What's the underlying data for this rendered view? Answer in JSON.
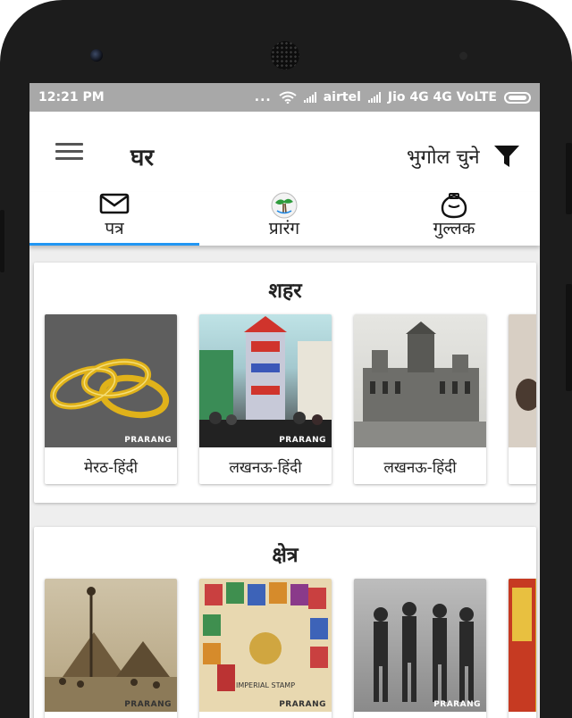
{
  "status_bar": {
    "time": "12:21 PM",
    "dots": "...",
    "carrier1": "airtel",
    "carrier2": "Jio 4G 4G VoLTE"
  },
  "appbar": {
    "title": "घर",
    "geo_filter_label": "भुगोल चुने"
  },
  "tabs": [
    {
      "label": "पत्र",
      "icon": "envelope-icon",
      "active": true
    },
    {
      "label": "प्रारंग",
      "icon": "prarang-logo-icon",
      "active": false
    },
    {
      "label": "गुल्लक",
      "icon": "piggy-bank-icon",
      "active": false
    }
  ],
  "sections": [
    {
      "title": "शहर",
      "tiles": [
        {
          "caption": "मेरठ-हिंदी",
          "watermark": "PRARANG"
        },
        {
          "caption": "लखनऊ-हिंदी",
          "watermark": "PRARANG"
        },
        {
          "caption": "लखनऊ-हिंदी",
          "watermark": ""
        },
        {
          "caption": "",
          "watermark": ""
        }
      ]
    },
    {
      "title": "क्षेत्र",
      "tiles": [
        {
          "caption": "",
          "watermark": "PRARANG"
        },
        {
          "caption": "",
          "watermark": "PRARANG"
        },
        {
          "caption": "",
          "watermark": "PRARANG"
        },
        {
          "caption": "",
          "watermark": ""
        }
      ]
    }
  ],
  "colors": {
    "accent": "#2196f3",
    "status_bar": "#a8a8a8",
    "phone_frame": "#1c1c1c"
  }
}
